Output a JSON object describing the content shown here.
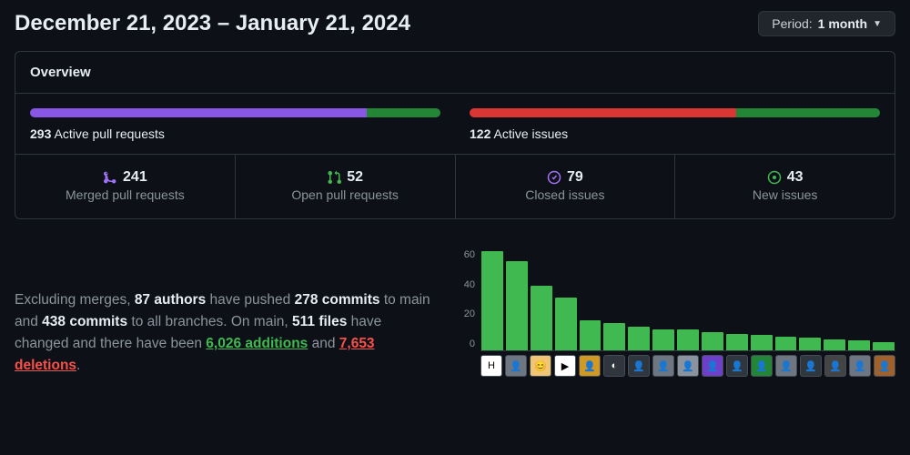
{
  "header": {
    "date_range": "December 21, 2023 – January 21, 2024",
    "period_label": "Period:",
    "period_value": "1 month"
  },
  "overview": {
    "title": "Overview",
    "pr_bar": {
      "count": "293",
      "label": "Active pull requests",
      "merged_pct": 82,
      "open_pct": 18
    },
    "issue_bar": {
      "count": "122",
      "label": "Active issues",
      "closed_pct": 65,
      "open_pct": 35
    },
    "stats": [
      {
        "icon": "merge",
        "count": "241",
        "label": "Merged pull requests",
        "color": "#a371f7"
      },
      {
        "icon": "pr-open",
        "count": "52",
        "label": "Open pull requests",
        "color": "#3fb950"
      },
      {
        "icon": "issue-closed",
        "count": "79",
        "label": "Closed issues",
        "color": "#a371f7"
      },
      {
        "icon": "issue-open",
        "count": "43",
        "label": "New issues",
        "color": "#3fb950"
      }
    ]
  },
  "summary": {
    "prefix": "Excluding merges, ",
    "authors": "87 authors",
    "mid1": " have pushed ",
    "commits_main": "278 commits",
    "mid2": " to main and ",
    "commits_all": "438 commits",
    "mid3": " to all branches. On main, ",
    "files": "511 files",
    "mid4": " have changed and there have been ",
    "additions": "6,026 additions",
    "mid5": " and ",
    "deletions": "7,653 deletions",
    "end": "."
  },
  "chart_data": {
    "type": "bar",
    "ylabel": "",
    "ylim": [
      0,
      72
    ],
    "y_ticks": [
      "60",
      "40",
      "20",
      "0"
    ],
    "values": [
      72,
      65,
      47,
      38,
      22,
      20,
      17,
      15,
      15,
      13,
      12,
      11,
      10,
      9,
      8,
      7,
      6
    ],
    "avatars": [
      "H",
      "👤",
      "😊",
      "▶",
      "👤",
      "◐",
      "👤",
      "👤",
      "👤",
      "👤",
      "👤",
      "👤",
      "👤",
      "👤",
      "👤",
      "👤",
      "👤"
    ]
  }
}
